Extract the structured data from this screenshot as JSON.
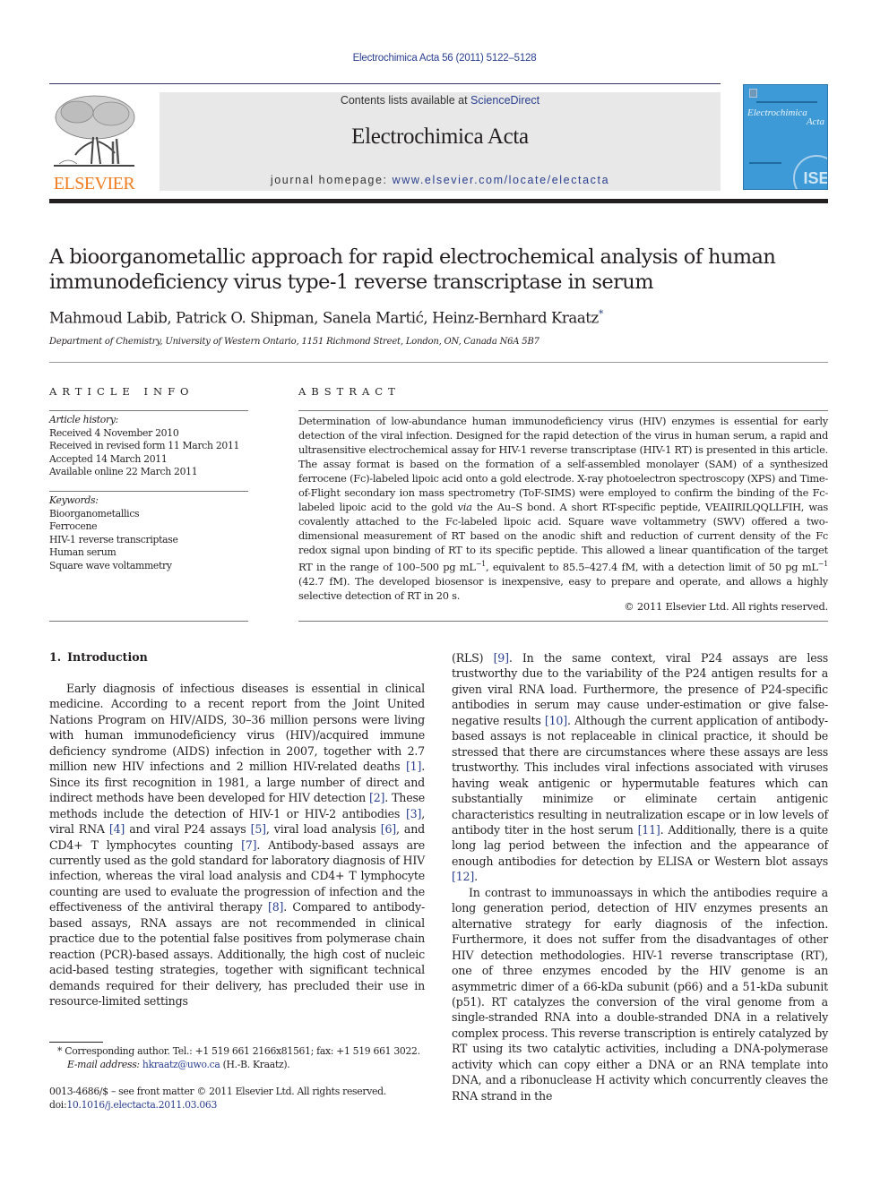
{
  "running_head": "Electrochimica Acta 56 (2011) 5122–5128",
  "masthead": {
    "publisher": "ELSEVIER",
    "contents_prefix": "Contents lists available at ",
    "contents_link": "ScienceDirect",
    "journal_title": "Electrochimica Acta",
    "homepage_prefix": "journal homepage: ",
    "homepage_link": "www.elsevier.com/locate/electacta",
    "cover_title_line1": "Electrochimica",
    "cover_title_line2": "Acta",
    "cover_badge": "ISE",
    "colors": {
      "publisher_orange": "#f07d21",
      "link_blue": "#2a3f8f",
      "cover_blue": "#3d9ad6",
      "masthead_gray": "#e8e8e8"
    }
  },
  "article": {
    "title_line1": "A bioorganometallic approach for rapid electrochemical analysis of human",
    "title_line2": "immunodeficiency virus type-1 reverse transcriptase in serum",
    "authors": "Mahmoud Labib, Patrick O. Shipman, Sanela Martić, Heinz-Bernhard Kraatz",
    "author_mark": "*",
    "affiliation": "Department of Chemistry, University of Western Ontario, 1151 Richmond Street, London, ON, Canada N6A 5B7"
  },
  "article_info": {
    "heading": "ARTICLE INFO",
    "history_label": "Article history:",
    "history": [
      "Received 4 November 2010",
      "Received in revised form 11 March 2011",
      "Accepted 14 March 2011",
      "Available online 22 March 2011"
    ],
    "keywords_label": "Keywords:",
    "keywords": [
      "Bioorganometallics",
      "Ferrocene",
      "HIV-1 reverse transcriptase",
      "Human serum",
      "Square wave voltammetry"
    ]
  },
  "abstract": {
    "heading": "ABSTRACT",
    "part1": "Determination of low-abundance human immunodeficiency virus (HIV) enzymes is essential for early detection of the viral infection. Designed for the rapid detection of the virus in human serum, a rapid and ultrasensitive electrochemical assay for HIV-1 reverse transcriptase (HIV-1 RT) is presented in this article. The assay format is based on the formation of a self-assembled monolayer (SAM) of a synthesized ferrocene (Fc)-labeled lipoic acid onto a gold electrode. X-ray photoelectron spectroscopy (XPS) and Time-of-Flight secondary ion mass spectrometry (ToF-SIMS) were employed to confirm the binding of the Fc-labeled lipoic acid to the gold ",
    "via": "via",
    "part2": " the Au–S bond. A short RT-specific peptide, VEAIIRILQQLLFIH, was covalently attached to the Fc-labeled lipoic acid. Square wave voltammetry (SWV) offered a two-dimensional measurement of RT based on the anodic shift and reduction of current density of the Fc redox signal upon binding of RT to its specific peptide. This allowed a linear quantification of the target RT in the range of 100–500 pg mL",
    "sup": "−1",
    "part3": ", equivalent to 85.5–427.4 fM, with a detection limit of 50 pg mL",
    "part4": " (42.7 fM). The developed biosensor is inexpensive, easy to prepare and operate, and allows a highly selective detection of RT in 20 s.",
    "copyright": "© 2011 Elsevier Ltd. All rights reserved."
  },
  "body": {
    "section_number": "1.",
    "section_title": "Introduction",
    "left_p1": [
      {
        "t": "Early diagnosis of infectious diseases is essential in clinical medicine. According to a recent report from the Joint United Nations Program on HIV/AIDS, 30–36 million persons were living with human immunodeficiency virus (HIV)/acquired immune deficiency syndrome (AIDS) infection in 2007, together with 2.7 million new HIV infections and 2 million HIV-related deaths "
      },
      {
        "ref": "[1]"
      },
      {
        "t": ". Since its first recognition in 1981, a large number of direct and indirect methods have been developed for HIV detection "
      },
      {
        "ref": "[2]"
      },
      {
        "t": ". These methods include the detection of HIV-1 or HIV-2 antibodies "
      },
      {
        "ref": "[3]"
      },
      {
        "t": ", viral RNA "
      },
      {
        "ref": "[4]"
      },
      {
        "t": " and viral P24 assays "
      },
      {
        "ref": "[5]"
      },
      {
        "t": ", viral load analysis "
      },
      {
        "ref": "[6]"
      },
      {
        "t": ", and CD4+ T lymphocytes counting "
      },
      {
        "ref": "[7]"
      },
      {
        "t": ". Antibody-based assays are currently used as the gold standard for laboratory diagnosis of HIV infection, whereas the viral load analysis and CD4+ T lymphocyte counting are used to evaluate the progression of infection and the effectiveness of the antiviral therapy "
      },
      {
        "ref": "[8]"
      },
      {
        "t": ". Compared to antibody-based assays, RNA assays are not recommended in clinical practice due to the potential false positives from polymerase chain reaction (PCR)-based assays. Additionally, the high cost of nucleic acid-based testing strategies, together with significant technical demands required for their delivery, has precluded their use in resource-limited settings"
      }
    ],
    "right_p1": [
      {
        "t": "(RLS) "
      },
      {
        "ref": "[9]"
      },
      {
        "t": ". In the same context, viral P24 assays are less trustworthy due to the variability of the P24 antigen results for a given viral RNA load. Furthermore, the presence of P24-specific antibodies in serum may cause under-estimation or give false-negative results "
      },
      {
        "ref": "[10]"
      },
      {
        "t": ". Although the current application of antibody-based assays is not replaceable in clinical practice, it should be stressed that there are circumstances where these assays are less trustworthy. This includes viral infections associated with viruses having weak antigenic or hypermutable features which can substantially minimize or eliminate certain antigenic characteristics resulting in neutralization escape or in low levels of antibody titer in the host serum "
      },
      {
        "ref": "[11]"
      },
      {
        "t": ". Additionally, there is a quite long lag period between the infection and the appearance of enough antibodies for detection by ELISA or Western blot assays "
      },
      {
        "ref": "[12]"
      },
      {
        "t": "."
      }
    ],
    "right_p2": "In contrast to immunoassays in which the antibodies require a long generation period, detection of HIV enzymes presents an alternative strategy for early diagnosis of the infection. Furthermore, it does not suffer from the disadvantages of other HIV detection methodologies. HIV-1 reverse transcriptase (RT), one of three enzymes encoded by the HIV genome is an asymmetric dimer of a 66-kDa subunit (p66) and a 51-kDa subunit (p51). RT catalyzes the conversion of the viral genome from a single-stranded RNA into a double-stranded DNA in a relatively complex process. This reverse transcription is entirely catalyzed by RT using its two catalytic activities, including a DNA-polymerase activity which can copy either a DNA or an RNA template into DNA, and a ribonuclease H activity which concurrently cleaves the RNA strand in the"
  },
  "footnote": {
    "mark": "*",
    "corresponding": " Corresponding author. Tel.: +1 519 661 2166x81561; fax: +1 519 661 3022.",
    "email_label": "E-mail address:",
    "email": "hkraatz@uwo.ca",
    "email_suffix": " (H.-B. Kraatz)."
  },
  "front_matter": {
    "issn_line": "0013-4686/$ – see front matter © 2011 Elsevier Ltd. All rights reserved.",
    "doi_prefix": "doi:",
    "doi": "10.1016/j.electacta.2011.03.063"
  }
}
